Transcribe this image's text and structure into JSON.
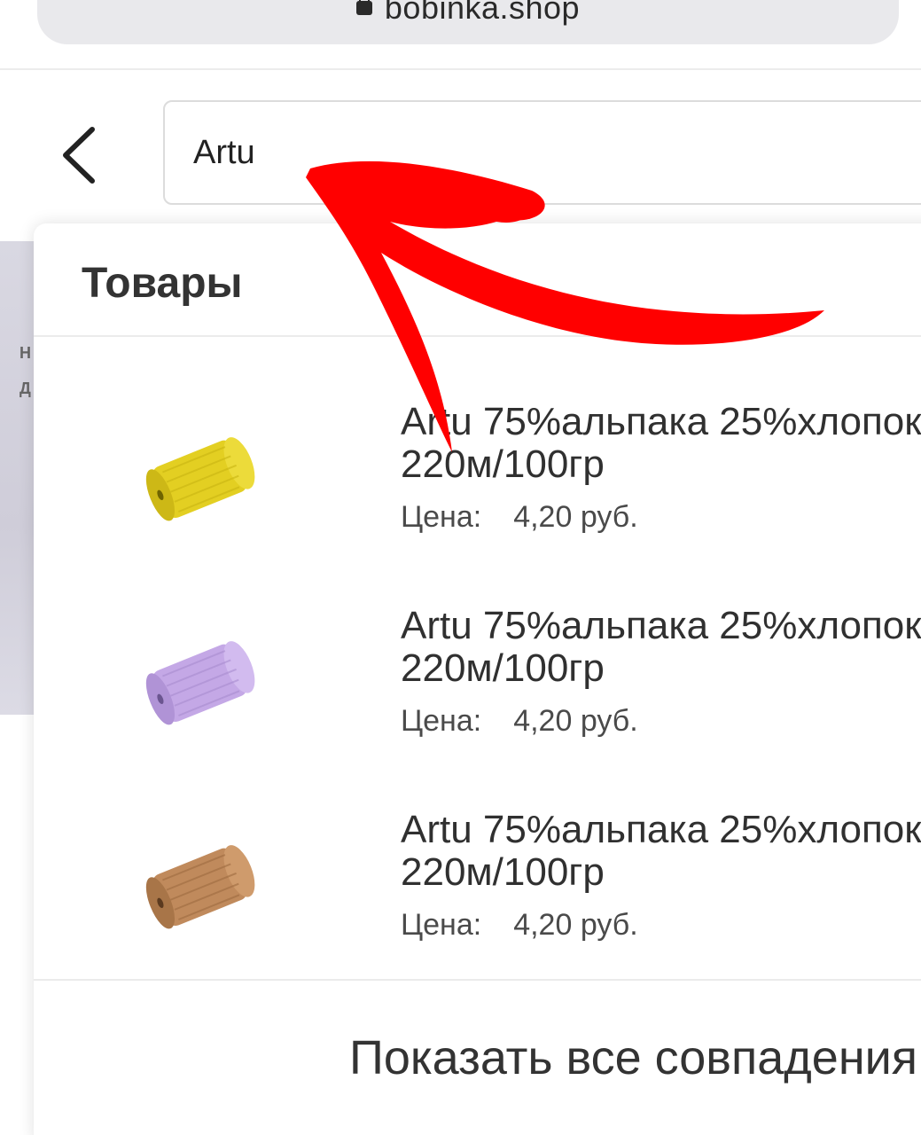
{
  "browser": {
    "url": "bobinka.shop",
    "lock_icon": "lock-icon",
    "share_icon": "share-icon"
  },
  "search": {
    "value": "Artu",
    "back_icon": "chevron-left-icon"
  },
  "background": {
    "letters": [
      "Н",
      "Д"
    ]
  },
  "dropdown": {
    "section_title": "Товары",
    "products": [
      {
        "title": "Artu 75%альпака 25%хлопок 220м/100гр",
        "price_label": "Цена:",
        "price": "4,20 руб.",
        "color": "#e3cf22"
      },
      {
        "title": "Artu 75%альпака 25%хлопок 220м/100гр",
        "price_label": "Цена:",
        "price": "4,20 руб.",
        "color": "#c4a8e6"
      },
      {
        "title": "Artu 75%альпака 25%хлопок 220м/100гр",
        "price_label": "Цена:",
        "price": "4,20 руб.",
        "color": "#c08a5c"
      }
    ],
    "show_all": "Показать все совпадения"
  },
  "annotation": {
    "arrow_color": "#ff0000"
  }
}
